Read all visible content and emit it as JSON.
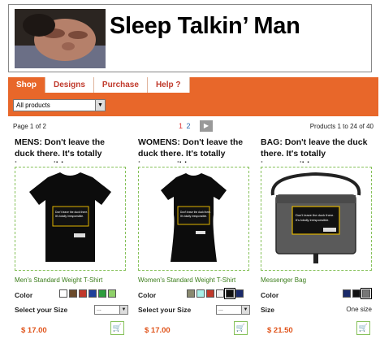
{
  "header": {
    "title": "Sleep Talkin’ Man"
  },
  "nav": {
    "tabs": [
      "Shop",
      "Designs",
      "Purchase",
      "Help ?"
    ],
    "category_select": "All products"
  },
  "pagination": {
    "page_of": "Page 1 of 2",
    "current_page": "1",
    "next_page": "2",
    "next_arrow": "▶",
    "products_count": "Products 1 to 24 of 40"
  },
  "products": [
    {
      "title": "MENS: Don't leave the duck there. It's totally irresponsible.",
      "name": "Men's Standard Weight T-Shirt",
      "color_label": "Color",
      "size_label": "Select your Size",
      "size_value": "...",
      "price": "$ 17.00",
      "swatch_colors": [
        "#ffffff",
        "#6b4a2b",
        "#c0392b",
        "#1f3f9a",
        "#2e9e3e",
        "#8fd16a"
      ]
    },
    {
      "title": "WOMENS: Don't leave the duck there. It's totally irresponsible.",
      "name": "Women's Standard Weight T-Shirt",
      "color_label": "Color",
      "size_label": "Select your Size",
      "size_value": "...",
      "price": "$ 17.00",
      "swatch_colors": [
        "#8a8a70",
        "#a8f0e8",
        "#c0392b",
        "#f0f0f0",
        "#111111",
        "#1a2a6a"
      ]
    },
    {
      "title": "BAG: Don't leave the duck there. It's totally irresponsible.",
      "name": "Messenger Bag",
      "color_label": "Color",
      "size_label": "Size",
      "size_value": "One size",
      "price": "$ 21.50",
      "swatch_colors": [
        "#1a2a6a",
        "#111111",
        "#777777"
      ]
    }
  ],
  "shirt_print": {
    "line1": "Don't leave the duck there.",
    "line2": "It's totally irresponsible."
  },
  "colors": {
    "accent": "#e8672a",
    "link_green": "#3c7d1c",
    "price": "#e0541b"
  }
}
